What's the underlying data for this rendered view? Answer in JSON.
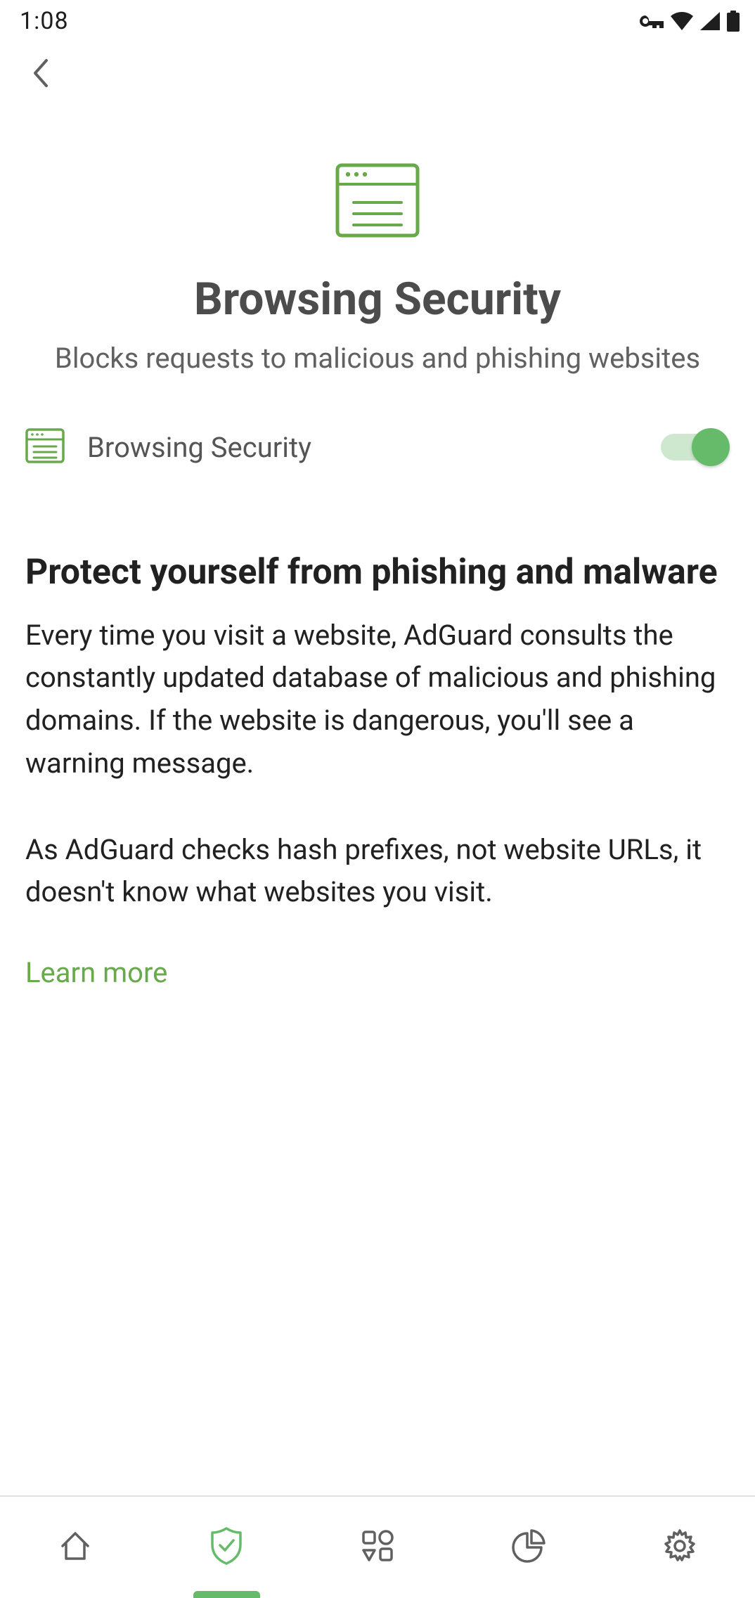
{
  "status": {
    "time": "1:08"
  },
  "colors": {
    "accent": "#66bb6a",
    "accentLight": "#a5d6a7",
    "iconGrey": "#606060",
    "heroGreen": "#68a94c"
  },
  "hero": {
    "title": "Browsing Security",
    "subtitle": "Blocks requests to malicious and phishing websites"
  },
  "toggle": {
    "label": "Browsing Security",
    "enabled": true
  },
  "info": {
    "heading": "Protect yourself from phishing and malware",
    "paragraph1": "Every time you visit a website, AdGuard consults the constantly updated database of malicious and phishing domains. If the website is dangerous, you'll see a warning message.",
    "paragraph2": "As AdGuard checks hash prefixes, not website URLs, it doesn't know what websites you visit.",
    "learnMore": "Learn more"
  },
  "nav": {
    "items": [
      "home",
      "protection",
      "apps",
      "stats",
      "settings"
    ],
    "activeIndex": 1
  }
}
